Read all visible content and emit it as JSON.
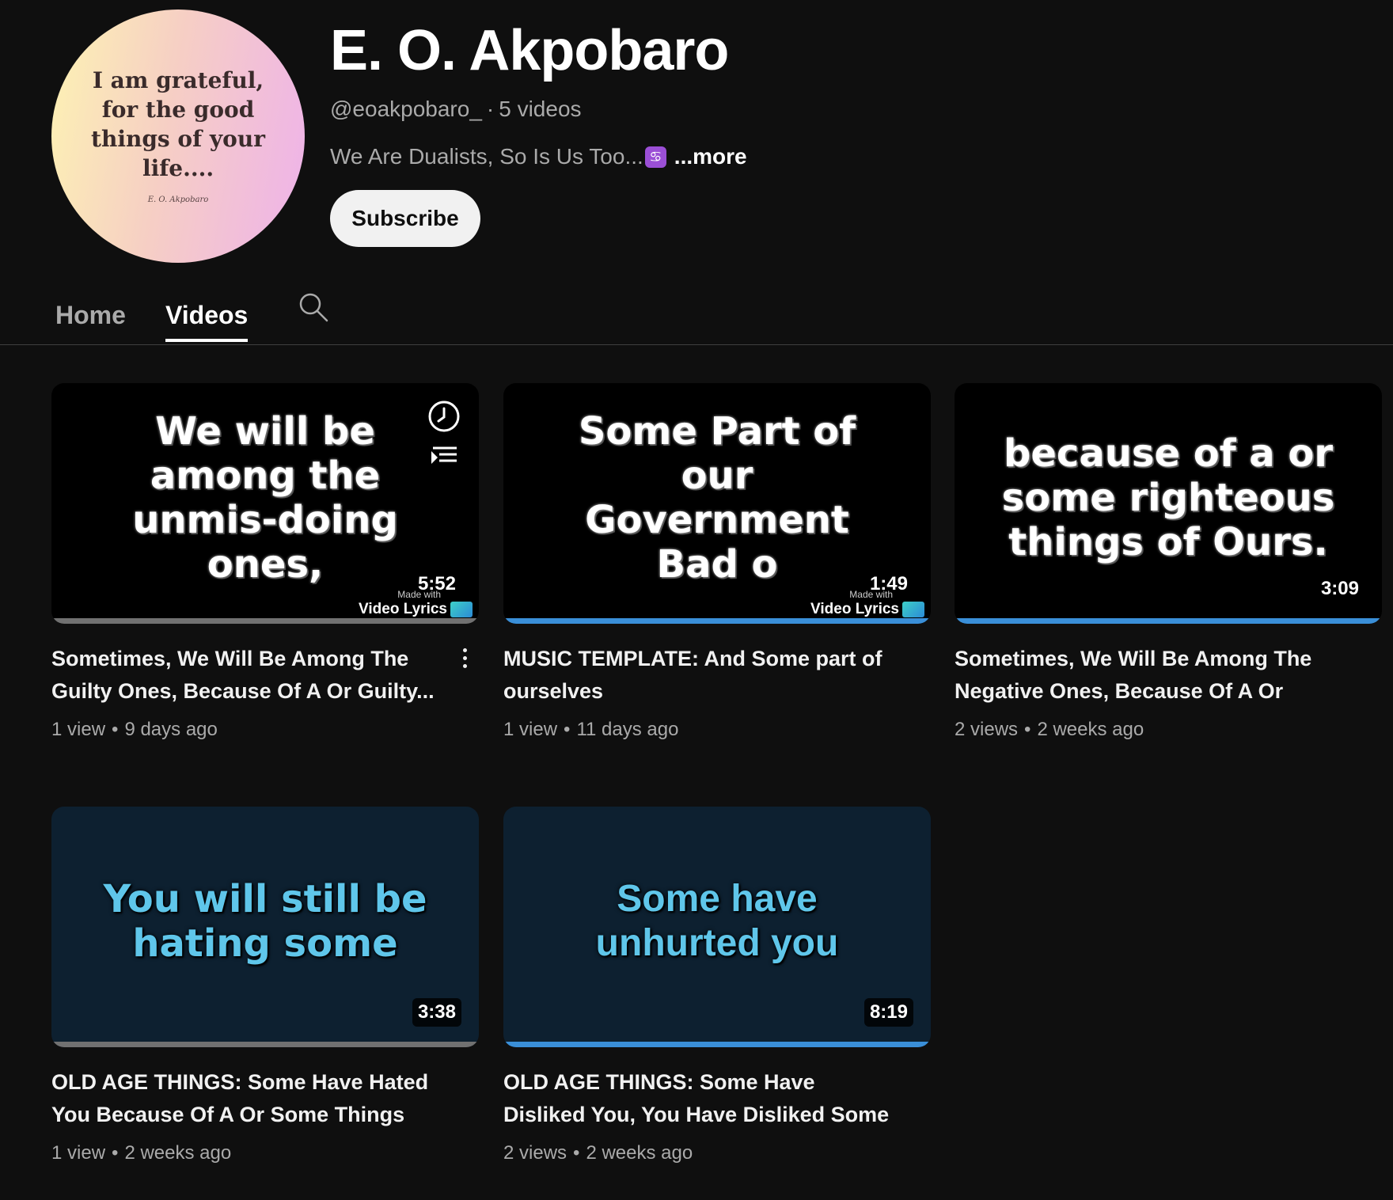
{
  "channel": {
    "avatar_quote": "I am grateful, for the good things of your life....",
    "avatar_signature": "E. O. Akpobaro",
    "name": "E. O. Akpobaro",
    "handle": "@eoakpobaro_",
    "separator": "·",
    "video_count": "5 videos",
    "description": "We Are Dualists, So Is Us Too...",
    "description_emoji": "♋",
    "more_label": "...more",
    "subscribe_label": "Subscribe"
  },
  "tabs": [
    {
      "label": "Home",
      "active": false
    },
    {
      "label": "Videos",
      "active": true
    }
  ],
  "meta_separator": "•",
  "videos": [
    {
      "thumb_text": "We will be among the unmis-doing ones,",
      "duration": "5:52",
      "watermark_small": "Made with",
      "watermark": "Video Lyrics",
      "title": "Sometimes, We Will Be Among The Guilty Ones, Because Of A Or Guilty...",
      "views": "1 view",
      "age": "9 days ago",
      "progress_color": "#717171"
    },
    {
      "thumb_text": "Some Part of our Government Bad o",
      "duration": "1:49",
      "watermark_small": "Made with",
      "watermark": "Video Lyrics",
      "title": "MUSIC TEMPLATE: And Some part of ourselves",
      "views": "1 view",
      "age": "11 days ago",
      "progress_color": "#3a8fd8"
    },
    {
      "thumb_text": "because of a or some righteous things of Ours.",
      "duration": "3:09",
      "title": "Sometimes, We Will Be Among The Negative Ones, Because Of A Or Som...",
      "views": "2 views",
      "age": "2 weeks ago",
      "progress_color": "#3a8fd8"
    },
    {
      "thumb_text": "You will still be hating some",
      "duration": "3:38",
      "title": "OLD AGE THINGS: Some Have Hated You Because Of A Or Some Things Of...",
      "views": "1 view",
      "age": "2 weeks ago",
      "progress_color": "#717171"
    },
    {
      "thumb_text": "Some have unhurted you",
      "duration": "8:19",
      "title": "OLD AGE THINGS: Some Have Disliked You, You Have Disliked Some",
      "views": "2 views",
      "age": "2 weeks ago",
      "progress_color": "#3a8fd8"
    }
  ],
  "icons": {
    "search": "search-icon",
    "watch_later": "clock-icon",
    "add_to_queue": "add-to-queue-icon",
    "more": "more-vert-icon"
  }
}
